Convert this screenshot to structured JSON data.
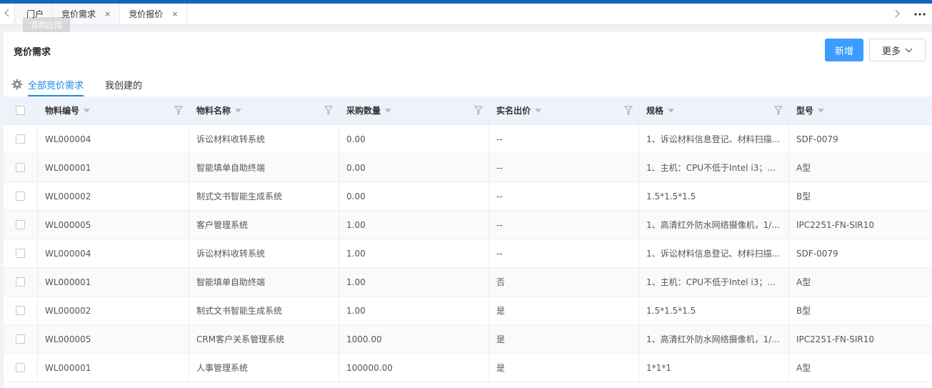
{
  "tabs": {
    "items": [
      {
        "label": "门户",
        "closable": false
      },
      {
        "label": "竞价需求",
        "closable": true
      },
      {
        "label": "竞价报价",
        "closable": true
      }
    ],
    "close_glyph": "×"
  },
  "tooltip": "我的应用",
  "page": {
    "title": "竞价需求",
    "add_button": "新增",
    "more_button": "更多"
  },
  "subtabs": {
    "all": "全部竞价需求",
    "mine": "我创建的"
  },
  "table": {
    "columns": [
      "物料编号",
      "物料名称",
      "采购数量",
      "实名出价",
      "规格",
      "型号"
    ],
    "rows": [
      [
        "WL000004",
        "诉讼材料收转系统",
        "0.00",
        "--",
        "1、诉讼材料信息登记、材料扫描...",
        "SDF-0079"
      ],
      [
        "WL000001",
        "智能填单自助终端",
        "0.00",
        "--",
        "1、主机：CPU不低于Intel i3；内...",
        "A型"
      ],
      [
        "WL000002",
        "制式文书智能生成系统",
        "0.00",
        "--",
        "1.5*1.5*1.5",
        "B型"
      ],
      [
        "WL000005",
        "客户管理系统",
        "1.00",
        "--",
        "1、高清红外防水网络摄像机，1/...",
        "IPC2251-FN-SIR10"
      ],
      [
        "WL000004",
        "诉讼材料收转系统",
        "1.00",
        "--",
        "1、诉讼材料信息登记、材料扫描...",
        "SDF-0079"
      ],
      [
        "WL000001",
        "智能填单自助终端",
        "1.00",
        "否",
        "1、主机：CPU不低于Intel i3；内...",
        "A型"
      ],
      [
        "WL000002",
        "制式文书智能生成系统",
        "1.00",
        "是",
        "1.5*1.5*1.5",
        "B型"
      ],
      [
        "WL000005",
        "CRM客户关系管理系统",
        "1000.00",
        "是",
        "1、高清红外防水网络摄像机，1/...",
        "IPC2251-FN-SIR10"
      ],
      [
        "WL000001",
        "人事管理系统",
        "100000.00",
        "是",
        "1*1*1",
        "A型"
      ]
    ]
  },
  "colors": {
    "primary": "#3c9cff",
    "active_tab": "#1e88e5",
    "header_bg": "#eef3fb",
    "topbar": "#1565c0"
  },
  "icons": [
    "chevron-left-icon",
    "chevron-right-icon",
    "more-dots-icon",
    "close-icon",
    "chevron-down-icon",
    "gear-icon",
    "sort-caret-icon",
    "filter-icon",
    "checkbox-icon"
  ]
}
